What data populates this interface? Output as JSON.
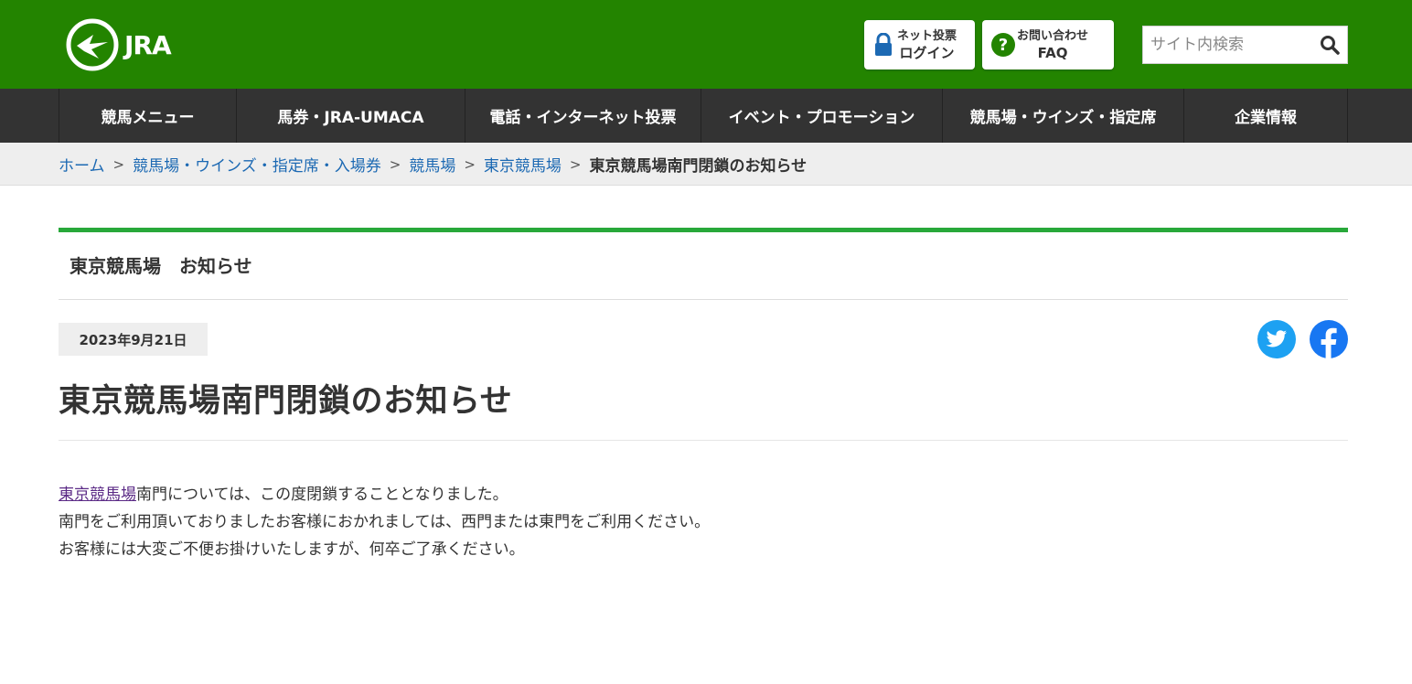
{
  "header": {
    "logo_text": "JRA",
    "net_vote": {
      "line1": "ネット投票",
      "line2": "ログイン"
    },
    "faq": {
      "line1": "お問い合わせ",
      "line2": "FAQ"
    },
    "search_placeholder": "サイト内検索"
  },
  "nav": [
    {
      "label": "競馬メニュー"
    },
    {
      "label": "馬券・JRA-UMACA"
    },
    {
      "label": "電話・インターネット投票"
    },
    {
      "label": "イベント・プロモーション"
    },
    {
      "label": "競馬場・ウインズ・指定席"
    },
    {
      "label": "企業情報"
    }
  ],
  "breadcrumb": {
    "items": [
      "ホーム",
      "競馬場・ウインズ・指定席・入場券",
      "競馬場",
      "東京競馬場"
    ],
    "current": "東京競馬場南門閉鎖のお知らせ",
    "separator": ">"
  },
  "section_title": "東京競馬場　お知らせ",
  "article": {
    "date": "2023年9月21日",
    "title": "東京競馬場南門閉鎖のお知らせ",
    "link_text": "東京競馬場",
    "line1_rest": "南門については、この度閉鎖することとなりました。",
    "line2": "南門をご利用頂いておりましたお客様におかれましては、西門または東門をご利用ください。",
    "line3": "お客様には大変ご不便お掛けいたしますが、何卒ご了承ください。"
  },
  "colors": {
    "header_green": "#238400",
    "nav_bg": "#333333",
    "accent_green": "#28a83a",
    "link_blue": "#1c69b3",
    "twitter": "#1da1f2",
    "facebook": "#1877f2"
  },
  "icons": {
    "logo": "jra-horse-logo-icon",
    "net_vote": "lock-icon",
    "faq": "question-circle-icon",
    "search": "search-icon",
    "twitter": "twitter-icon",
    "facebook": "facebook-icon"
  }
}
